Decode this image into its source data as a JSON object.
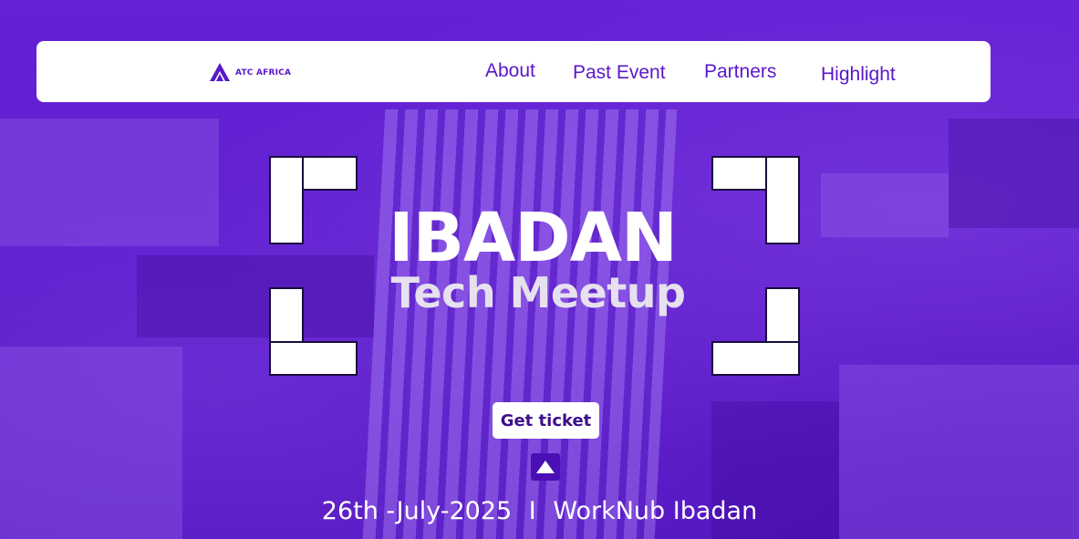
{
  "navbar": {
    "logo_text": "ATC AFRICA",
    "links": [
      {
        "label": "About"
      },
      {
        "label": "Past Event"
      },
      {
        "label": "Partners"
      },
      {
        "label": "Highlight"
      }
    ]
  },
  "hero": {
    "title_line1": "IBADAN",
    "title_line2": "Tech Meetup",
    "cta_label": "Get ticket",
    "event_date": "26th -July-2025",
    "separator": "I",
    "venue": "WorkNub Ibadan"
  },
  "icons": {
    "logo": "atc-africa-logo-icon",
    "scroll": "triangle-up-icon"
  },
  "colors": {
    "brand": "#5a17c9",
    "background_overlay": "#5a17c9",
    "navbar_bg": "#ffffff",
    "text_light": "#ffffff"
  }
}
